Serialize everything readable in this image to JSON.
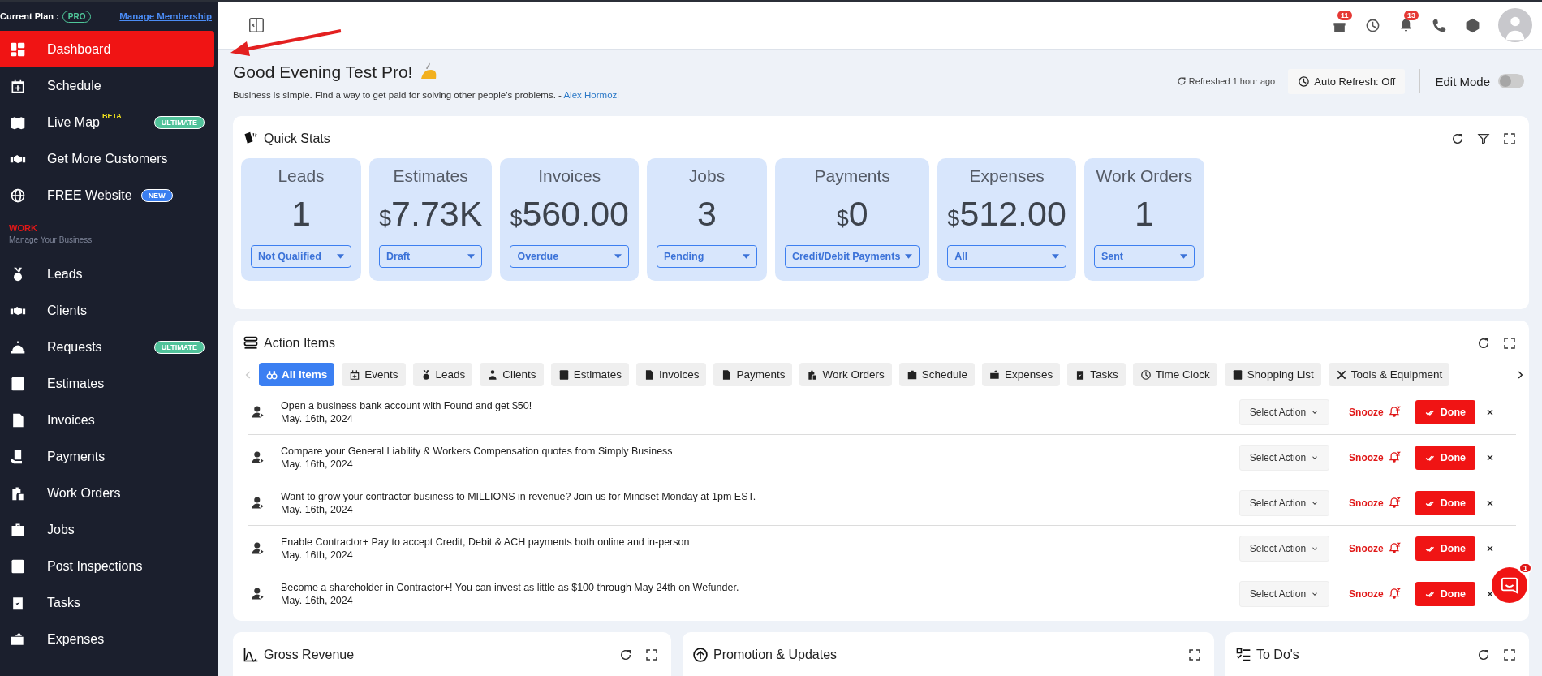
{
  "sidebar": {
    "plan_label": "Current Plan :",
    "plan": "PRO",
    "membership_link": "Manage Membership",
    "items": [
      {
        "label": "Dashboard",
        "selected": true
      },
      {
        "label": "Schedule",
        "selected": false
      },
      {
        "label": "Live Map",
        "sup": "BETA",
        "badge": {
          "text": "ULTIMATE",
          "kind": "tier",
          "color": "#51c29a"
        },
        "selected": false
      },
      {
        "label": "Get More Customers",
        "selected": false
      },
      {
        "label": "FREE Website",
        "badge": {
          "text": "NEW",
          "kind": "new",
          "color": "#3a7ef0"
        },
        "selected": false
      }
    ],
    "section": {
      "title": "WORK",
      "subtitle": "Manage Your Business"
    },
    "work_items": [
      {
        "label": "Leads",
        "selected": false
      },
      {
        "label": "Clients",
        "selected": false
      },
      {
        "label": "Requests",
        "badge": {
          "text": "ULTIMATE",
          "kind": "tier",
          "color": "#51c29a"
        },
        "selected": false
      },
      {
        "label": "Estimates",
        "selected": false
      },
      {
        "label": "Invoices",
        "selected": false
      },
      {
        "label": "Payments",
        "selected": false
      },
      {
        "label": "Work Orders",
        "selected": false
      },
      {
        "label": "Jobs",
        "selected": false
      },
      {
        "label": "Post Inspections",
        "selected": false
      },
      {
        "label": "Tasks",
        "selected": false
      },
      {
        "label": "Expenses",
        "selected": false
      }
    ]
  },
  "header": {
    "gift_badge": "11",
    "bell_badge": "13"
  },
  "greeting": {
    "title": "Good Evening Test Pro!",
    "quote": "Business is simple. Find a way to get paid for solving other people's problems. - ",
    "author": "Alex Hormozi",
    "refreshed": "Refreshed 1 hour ago",
    "auto_refresh": "Auto Refresh: Off",
    "edit_mode": {
      "label": "Edit Mode",
      "on": false
    }
  },
  "quick_stats": {
    "title": "Quick Stats",
    "stats": [
      {
        "label": "Leads",
        "value": "1",
        "filter": "Not Qualified"
      },
      {
        "label": "Estimates",
        "currency": "$",
        "value": "7.73K",
        "filter": "Draft"
      },
      {
        "label": "Invoices",
        "currency": "$",
        "value": "560.00",
        "filter": "Overdue"
      },
      {
        "label": "Jobs",
        "value": "3",
        "filter": "Pending"
      },
      {
        "label": "Payments",
        "currency": "$",
        "value": "0",
        "filter": "Credit/Debit Payments"
      },
      {
        "label": "Expenses",
        "currency": "$",
        "value": "512.00",
        "filter": "All"
      },
      {
        "label": "Work Orders",
        "value": "1",
        "filter": "Sent"
      }
    ]
  },
  "action_items": {
    "title": "Action Items",
    "tabs": [
      {
        "label": "All Items",
        "selected": true
      },
      {
        "label": "Events",
        "selected": false
      },
      {
        "label": "Leads",
        "selected": false
      },
      {
        "label": "Clients",
        "selected": false
      },
      {
        "label": "Estimates",
        "selected": false
      },
      {
        "label": "Invoices",
        "selected": false
      },
      {
        "label": "Payments",
        "selected": false
      },
      {
        "label": "Work Orders",
        "selected": false
      },
      {
        "label": "Schedule",
        "selected": false
      },
      {
        "label": "Expenses",
        "selected": false
      },
      {
        "label": "Tasks",
        "selected": false
      },
      {
        "label": "Time Clock",
        "selected": false
      },
      {
        "label": "Shopping List",
        "selected": false
      },
      {
        "label": "Tools & Equipment",
        "selected": false
      }
    ],
    "rows": [
      {
        "text": "Open a business bank account with Found and get $50!",
        "date": "May. 16th, 2024",
        "select": "Select Action",
        "snooze": "Snooze",
        "done": "Done"
      },
      {
        "text": "Compare your General Liability & Workers Compensation quotes from Simply Business",
        "date": "May. 16th, 2024",
        "select": "Select Action",
        "snooze": "Snooze",
        "done": "Done"
      },
      {
        "text": "Want to grow your contractor business to MILLIONS in revenue? Join us for Mindset Monday at 1pm EST.",
        "date": "May. 16th, 2024",
        "select": "Select Action",
        "snooze": "Snooze",
        "done": "Done"
      },
      {
        "text": "Enable Contractor+ Pay to accept Credit, Debit & ACH payments both online and in-person",
        "date": "May. 16th, 2024",
        "select": "Select Action",
        "snooze": "Snooze",
        "done": "Done"
      },
      {
        "text": "Become a shareholder in Contractor+! You can invest as little as $100 through May 24th on Wefunder.",
        "date": "May. 16th, 2024",
        "select": "Select Action",
        "snooze": "Snooze",
        "done": "Done"
      }
    ]
  },
  "panels": [
    {
      "title": "Gross Revenue",
      "refresh": true
    },
    {
      "title": "Promotion & Updates",
      "refresh": false
    },
    {
      "title": "To Do's",
      "refresh": true
    }
  ],
  "chat": {
    "badge": "1"
  }
}
